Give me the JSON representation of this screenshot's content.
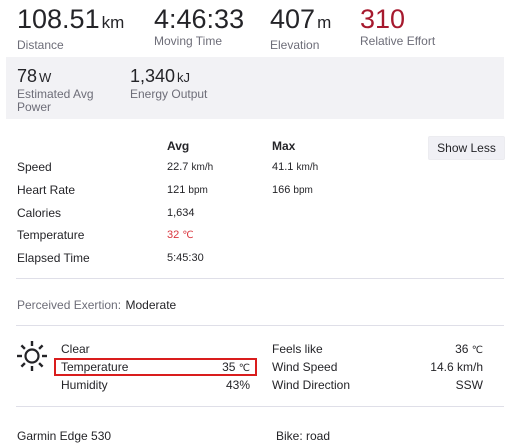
{
  "stats": {
    "distance": {
      "value": "108.51",
      "unit": "km",
      "label": "Distance"
    },
    "moving_time": {
      "value": "4:46:33",
      "label": "Moving Time"
    },
    "elevation": {
      "value": "407",
      "unit": "m",
      "label": "Elevation"
    },
    "relative_effort": {
      "value": "310",
      "label": "Relative Effort"
    }
  },
  "power": {
    "avg_power": {
      "value": "78",
      "unit": "W",
      "label_line1": "Estimated Avg",
      "label_line2": "Power"
    },
    "energy": {
      "value": "1,340",
      "unit": "kJ",
      "label": "Energy Output"
    }
  },
  "table": {
    "header_avg": "Avg",
    "header_max": "Max",
    "show_less": "Show Less",
    "rows": [
      {
        "label": "Speed",
        "avg": "22.7",
        "avg_unit": "km/h",
        "max": "41.1",
        "max_unit": "km/h"
      },
      {
        "label": "Heart Rate",
        "avg": "121",
        "avg_unit": "bpm",
        "max": "166",
        "max_unit": "bpm"
      },
      {
        "label": "Calories",
        "avg": "1,634"
      },
      {
        "label": "Temperature",
        "avg": "32",
        "avg_unit": "℃"
      },
      {
        "label": "Elapsed Time",
        "avg": "5:45:30"
      }
    ]
  },
  "exertion": {
    "label": "Perceived Exertion:",
    "value": "Moderate"
  },
  "weather": {
    "icon": "sun-icon",
    "condition": "Clear",
    "temperature_label": "Temperature",
    "temperature_value": "35",
    "temperature_unit": "℃",
    "humidity_label": "Humidity",
    "humidity_value": "43%",
    "feels_like_label": "Feels like",
    "feels_like_value": "36",
    "feels_like_unit": "℃",
    "wind_speed_label": "Wind Speed",
    "wind_speed_value": "14.6 km/h",
    "wind_dir_label": "Wind Direction",
    "wind_dir_value": "SSW"
  },
  "footer": {
    "device": "Garmin Edge 530",
    "bike": "Bike: road"
  },
  "colors": {
    "accent_red": "#a6192e",
    "temp_red": "#d9363e",
    "highlight": "#d91d1d"
  }
}
